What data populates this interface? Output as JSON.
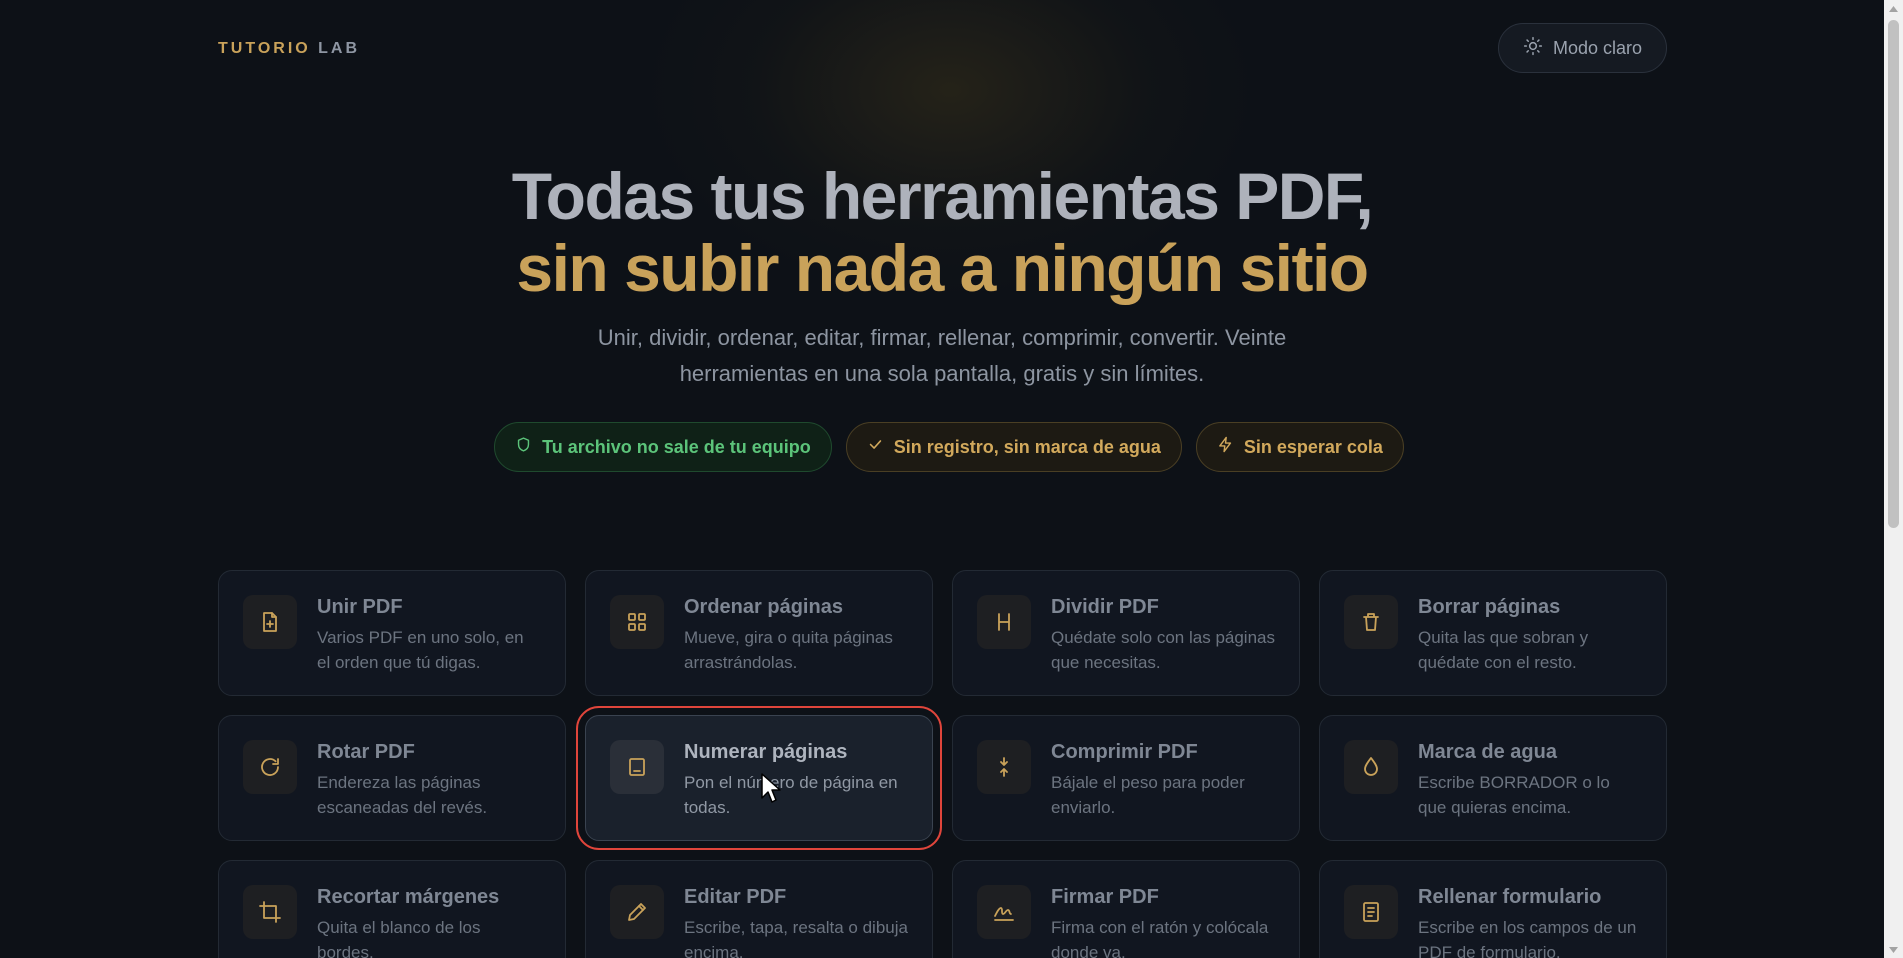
{
  "header": {
    "brand_main": "TUTORIO",
    "brand_lab": "LAB",
    "theme_button": "Modo claro"
  },
  "hero": {
    "title_line1": "Todas tus herramientas PDF,",
    "title_line2": "sin subir nada a ningún sitio",
    "subtitle": "Unir, dividir, ordenar, editar, firmar, rellenar, comprimir, convertir. Veinte herramientas en una sola pantalla, gratis y sin límites.",
    "chips": [
      {
        "label": "Tu archivo no sale de tu equipo",
        "icon": "shield-icon"
      },
      {
        "label": "Sin registro, sin marca de agua",
        "icon": "check-icon"
      },
      {
        "label": "Sin esperar cola",
        "icon": "bolt-icon"
      }
    ]
  },
  "tools": [
    {
      "title": "Unir PDF",
      "desc": "Varios PDF en uno solo, en el orden que tú digas.",
      "icon": "file-plus-icon"
    },
    {
      "title": "Ordenar páginas",
      "desc": "Mueve, gira o quita páginas arrastrándolas.",
      "icon": "grid-icon"
    },
    {
      "title": "Dividir PDF",
      "desc": "Quédate solo con las páginas que necesitas.",
      "icon": "split-icon"
    },
    {
      "title": "Borrar páginas",
      "desc": "Quita las que sobran y quédate con el resto.",
      "icon": "trash-icon"
    },
    {
      "title": "Rotar PDF",
      "desc": "Endereza las páginas escaneadas del revés.",
      "icon": "rotate-icon"
    },
    {
      "title": "Numerar páginas",
      "desc": "Pon el número de página en todas.",
      "icon": "page-number-icon"
    },
    {
      "title": "Comprimir PDF",
      "desc": "Bájale el peso para poder enviarlo.",
      "icon": "compress-icon"
    },
    {
      "title": "Marca de agua",
      "desc": "Escribe BORRADOR o lo que quieras encima.",
      "icon": "droplet-icon"
    },
    {
      "title": "Recortar márgenes",
      "desc": "Quita el blanco de los bordes.",
      "icon": "crop-icon"
    },
    {
      "title": "Editar PDF",
      "desc": "Escribe, tapa, resalta o dibuja encima.",
      "icon": "pencil-icon"
    },
    {
      "title": "Firmar PDF",
      "desc": "Firma con el ratón y colócala donde va.",
      "icon": "signature-icon"
    },
    {
      "title": "Rellenar formulario",
      "desc": "Escribe en los campos de un PDF de formulario.",
      "icon": "form-icon"
    }
  ],
  "colors": {
    "accent_gold": "#c9a25a",
    "chip_green": "#5cc47a",
    "highlight_red": "#e0453b",
    "background": "#0d1117"
  }
}
